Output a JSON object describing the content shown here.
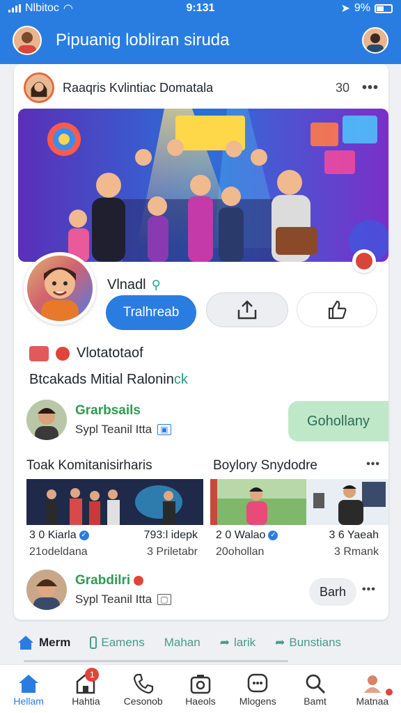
{
  "status_bar": {
    "carrier": "Nlbitoc",
    "time": "9:131",
    "battery": "9%"
  },
  "app_bar": {
    "title": "Pipuanig lobliran siruda"
  },
  "post": {
    "author": "Raaqris Kvlintiac Domatala",
    "count": "30",
    "profile_name": "Vlnadl",
    "primary_button": "Tralhreab",
    "info_line": "Vlotatotaof",
    "info_line2_prefix": "Btcakads Mitial Ralonin",
    "info_line2_accent": "ck"
  },
  "person_1": {
    "name": "Grarbsails",
    "sub": "Sypl Teanil Itta",
    "follow_label": "Gohollany"
  },
  "sections": {
    "left_title": "Toak Komitanisirharis",
    "right_title": "Boylory Snydodre"
  },
  "videos": [
    {
      "views": "3 0 Kiarla",
      "sub": "21odeldana"
    },
    {
      "views": "793:l idepk",
      "sub": "3 Priletabr"
    },
    {
      "views": "2 0 Walao",
      "sub": "20ohollan"
    },
    {
      "views": "3 6 Yaeah",
      "sub": "3 Rmank"
    }
  ],
  "person_2": {
    "name": "Grabdilri",
    "sub": "Sypl Teanil Itta",
    "pill": "Barh"
  },
  "tabs": [
    {
      "label": "Merm",
      "icon": "home-icon"
    },
    {
      "label": "Eamens",
      "icon": "device-icon"
    },
    {
      "label": "Mahan",
      "icon": ""
    },
    {
      "label": "larik",
      "icon": "share-icon"
    },
    {
      "label": "Bunstians",
      "icon": "share-icon"
    }
  ],
  "bottom_nav": [
    {
      "label": "Hellam",
      "icon": "home-icon",
      "badge": ""
    },
    {
      "label": "Hahtia",
      "icon": "notification-icon",
      "badge": "1"
    },
    {
      "label": "Cesonob",
      "icon": "phone-icon",
      "badge": ""
    },
    {
      "label": "Haeols",
      "icon": "camera-icon",
      "badge": ""
    },
    {
      "label": "Mlogens",
      "icon": "chat-icon",
      "badge": ""
    },
    {
      "label": "Bamt",
      "icon": "search-icon",
      "badge": ""
    },
    {
      "label": "Matnaa",
      "icon": "profile-icon",
      "badge": ""
    }
  ],
  "colors": {
    "brand": "#2a7de0",
    "accent_green": "#2e9b52",
    "teal": "#1f9a8a",
    "badge_red": "#e0453a"
  }
}
